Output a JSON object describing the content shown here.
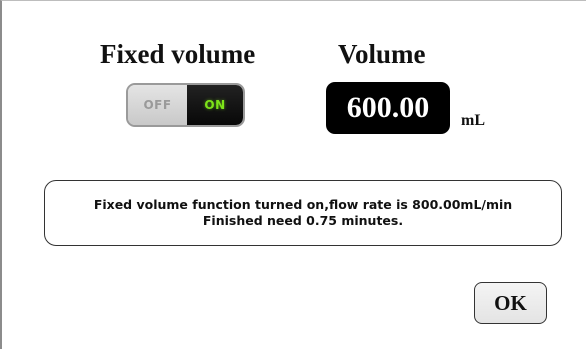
{
  "fixed_volume": {
    "title": "Fixed volume",
    "toggle": {
      "off_label": "OFF",
      "on_label": "ON",
      "state": "on",
      "on_text_color": "#7de319"
    }
  },
  "volume": {
    "title": "Volume",
    "value": "600.00",
    "unit": "mL"
  },
  "message": {
    "line1": "Fixed volume function turned on,flow rate is 800.00mL/min",
    "line2": "Finished need 0.75 minutes."
  },
  "ok_button": {
    "label": "OK"
  }
}
